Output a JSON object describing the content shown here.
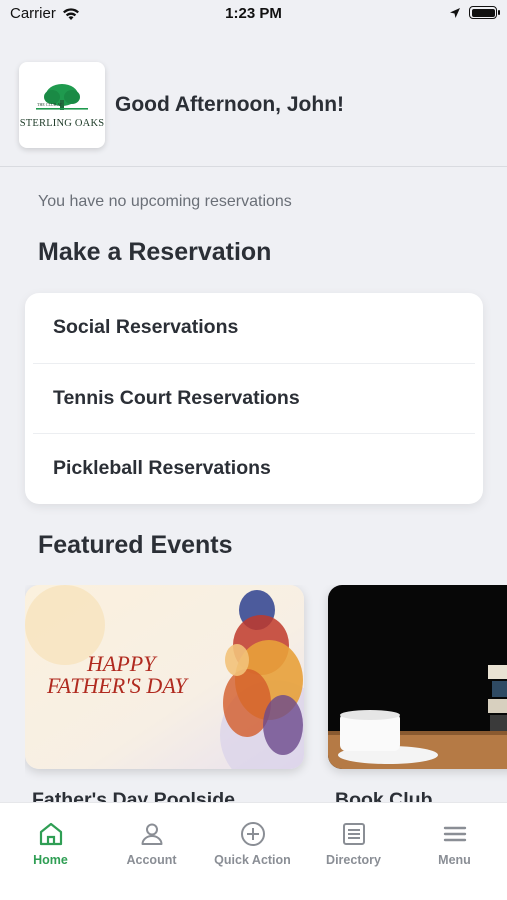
{
  "status_bar": {
    "carrier": "Carrier",
    "time": "1:23 PM"
  },
  "header": {
    "logo_text": "STERLING OAKS",
    "logo_small_text": "THE CLUB AT",
    "greeting": "Good Afternoon, John!"
  },
  "reservations": {
    "empty_message": "You have no upcoming reservations",
    "section_title": "Make a Reservation",
    "items": [
      {
        "label": "Social Reservations"
      },
      {
        "label": "Tennis Court Reservations"
      },
      {
        "label": "Pickleball Reservations"
      }
    ]
  },
  "events": {
    "section_title": "Featured Events",
    "items": [
      {
        "title": "Father's Day Poolside",
        "image_text_1": "HAPPY",
        "image_text_2": "FATHER'S DAY"
      },
      {
        "title": "Book Club"
      }
    ]
  },
  "tab_bar": {
    "tabs": [
      {
        "label": "Home",
        "icon": "home-icon",
        "active": true
      },
      {
        "label": "Account",
        "icon": "account-icon"
      },
      {
        "label": "Quick Action",
        "icon": "plus-circle-icon"
      },
      {
        "label": "Directory",
        "icon": "directory-icon"
      },
      {
        "label": "Menu",
        "icon": "menu-icon"
      }
    ]
  },
  "colors": {
    "accent": "#2f9e54",
    "background": "#eff0f4",
    "text": "#2b2f36"
  }
}
